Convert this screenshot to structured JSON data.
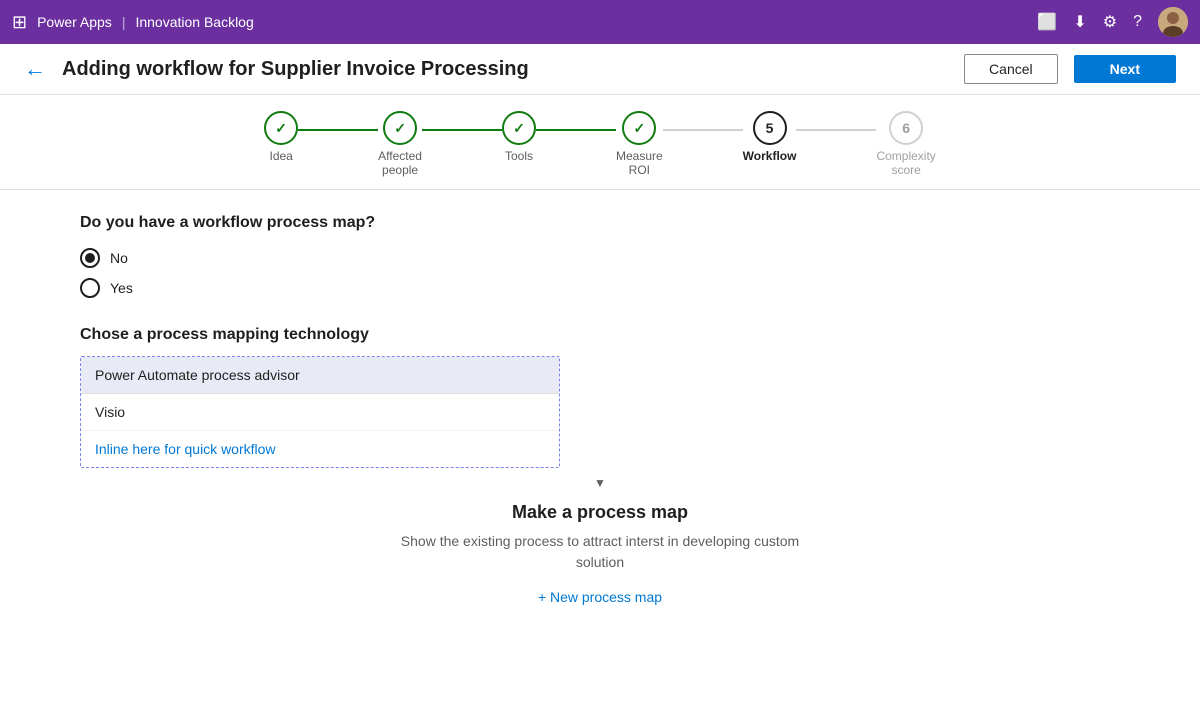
{
  "topbar": {
    "app_name": "Power Apps",
    "separator": "|",
    "section_name": "Innovation Backlog"
  },
  "header": {
    "back_label": "←",
    "title": "Adding workflow for Supplier Invoice Processing",
    "cancel_label": "Cancel",
    "next_label": "Next"
  },
  "stepper": {
    "steps": [
      {
        "id": "idea",
        "label": "Idea",
        "state": "done",
        "number": "✓"
      },
      {
        "id": "affected-people",
        "label": "Affected people",
        "state": "done",
        "number": "✓"
      },
      {
        "id": "tools",
        "label": "Tools",
        "state": "done",
        "number": "✓"
      },
      {
        "id": "measure-roi",
        "label": "Measure ROI",
        "state": "done",
        "number": "✓"
      },
      {
        "id": "workflow",
        "label": "Workflow",
        "state": "active",
        "number": "5"
      },
      {
        "id": "complexity-score",
        "label": "Complexity score",
        "state": "inactive",
        "number": "6"
      }
    ]
  },
  "content": {
    "workflow_question": "Do you have a workflow process map?",
    "radio_options": [
      {
        "label": "No",
        "selected": true
      },
      {
        "label": "Yes",
        "selected": false
      }
    ],
    "process_tech_title": "Chose a process mapping technology",
    "dropdown_options": [
      {
        "label": "Power Automate process advisor",
        "selected": true
      },
      {
        "label": "Visio",
        "selected": false
      },
      {
        "label": "Inline here for quick workflow",
        "selected": false,
        "style": "link"
      }
    ],
    "process_map_title": "Make a process map",
    "process_map_desc": "Show the existing process to attract interst in developing custom solution",
    "new_process_label": "+ New process map"
  }
}
